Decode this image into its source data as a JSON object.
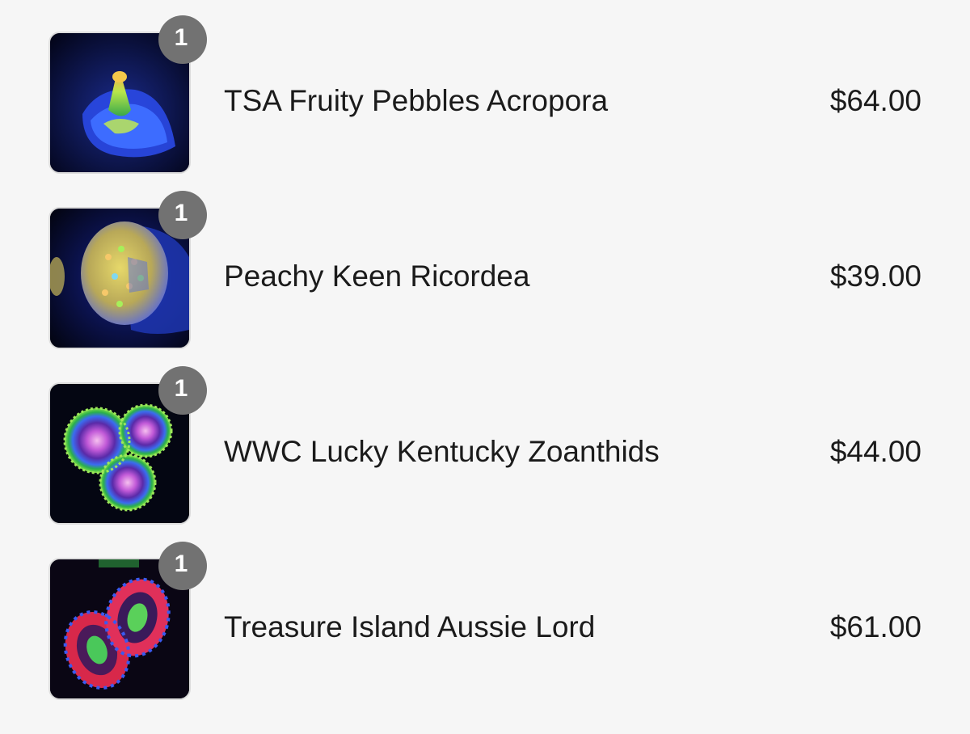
{
  "cart_items": [
    {
      "name": "TSA Fruity Pebbles Acropora",
      "price": "$64.00",
      "quantity": "1",
      "image": "acropora-coral-photo"
    },
    {
      "name": "Peachy Keen Ricordea",
      "price": "$39.00",
      "quantity": "1",
      "image": "ricordea-coral-photo"
    },
    {
      "name": "WWC Lucky Kentucky Zoanthids",
      "price": "$44.00",
      "quantity": "1",
      "image": "zoanthid-coral-photo"
    },
    {
      "name": "Treasure Island Aussie Lord",
      "price": "$61.00",
      "quantity": "1",
      "image": "acan-lord-coral-photo"
    }
  ],
  "colors": {
    "background": "#f6f6f6",
    "badge": "#727272",
    "text": "#1b1b1b"
  }
}
